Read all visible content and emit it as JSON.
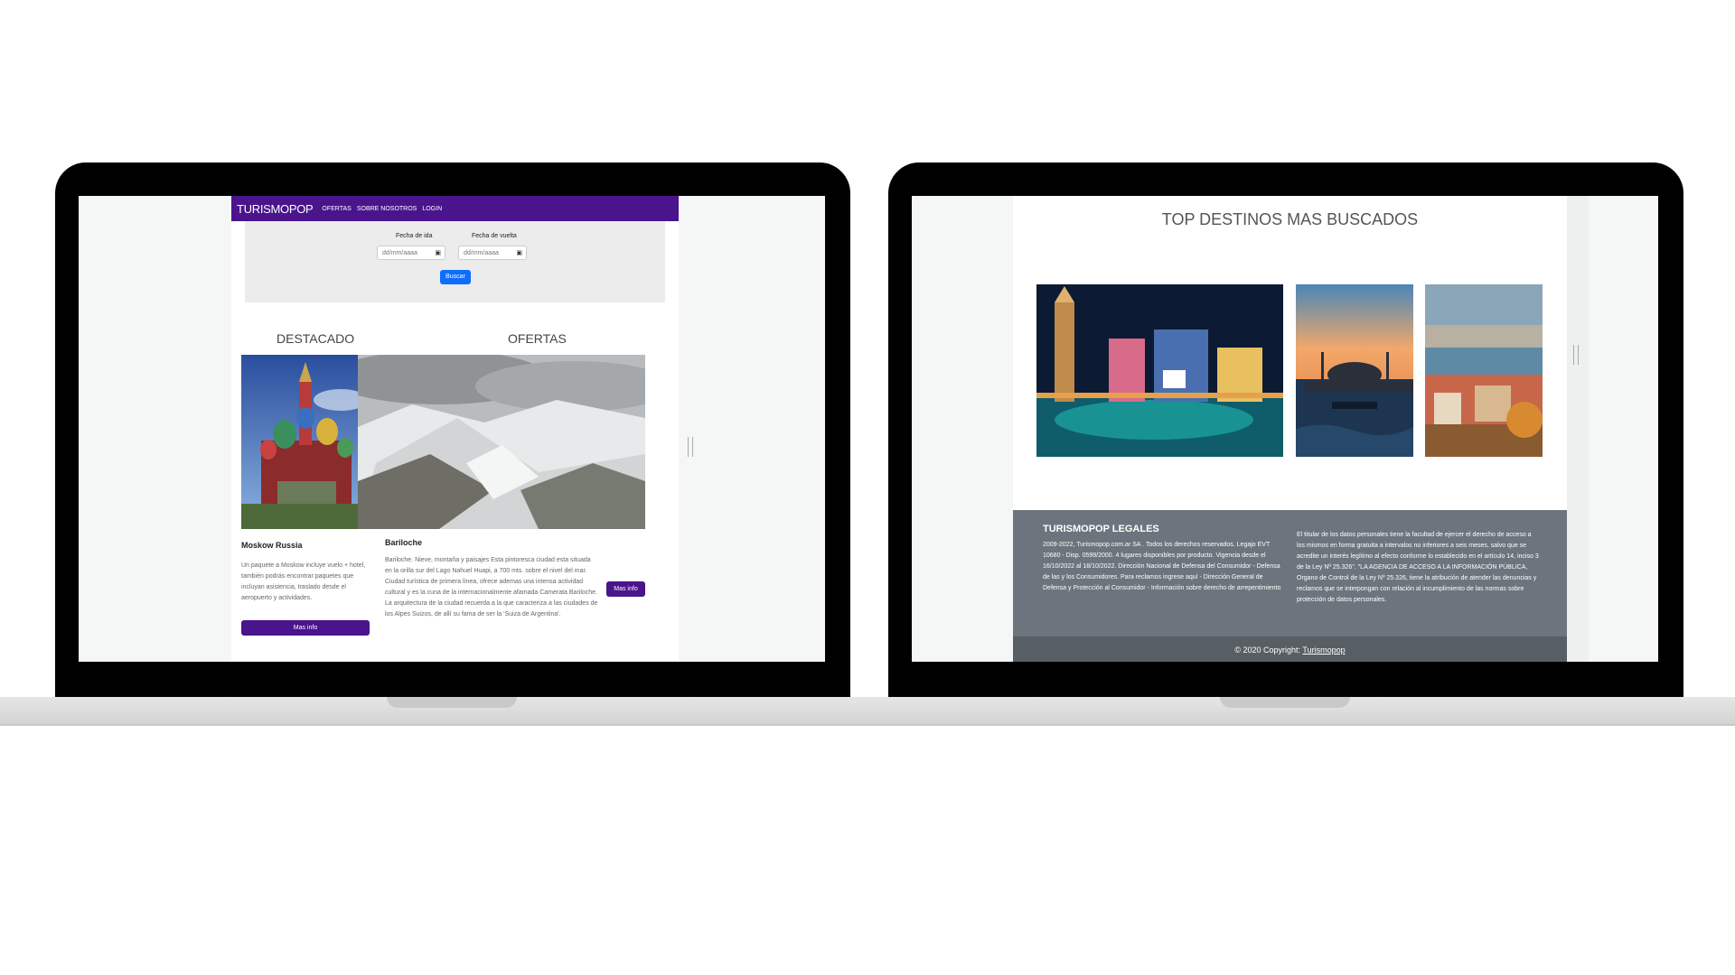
{
  "left": {
    "navbar": {
      "brand": "TURISMOPOP",
      "links": [
        "OFERTAS",
        "SOBRE NOSOTROS",
        "LOGIN"
      ]
    },
    "search": {
      "fecha_ida_label": "Fecha de ida",
      "fecha_vuelta_label": "Fecha de vuelta",
      "date_placeholder": "dd/mm/aaaa",
      "buscar_label": "Buscar"
    },
    "destacado": {
      "title": "DESTACADO",
      "card_title": "Moskow Russia",
      "card_text": "Un paquete a Moskow incluye vuelo + hotel, también podrás encontrar paquetes que incluyan asistencia, traslado desde el aeropuerto y actividades.",
      "button": "Mas info"
    },
    "ofertas": {
      "title": "OFERTAS",
      "card_title": "Bariloche",
      "card_text": "Bariloche. Nieve, montaña y paisajes Esta pintoresca ciudad esta situada en la orilla sur del Lago Nahuel Huapi, a 700 mts. sobre el nivel del mar. Ciudad turística de primera línea, ofrece ademas una intensa actividad cultural y es la cuna de la internacionalmente afamada Camerata Bariloche. La arquitectura de la ciudad recuerda a la que caracteriza a las ciudades de los Alpes Suizos, de allí su fama de ser la 'Suiza de Argentina'.",
      "button": "Mas info"
    }
  },
  "right": {
    "top_title": "TOP DESTINOS MAS BUSCADOS",
    "footer": {
      "title": "TURISMOPOP LEGALES",
      "text_left": "2009-2022, Turismopop.com.ar SA . Todos los derechos reservados. Legajo EVT 10680 - Disp. 0599/2000. 4 lugares disponibles por producto. Vigencia desde el 16/10/2022 al 18/10/2022. Dirección Nacional de Defensa del Consumidor - Defensa de las y los Consumidores. Para reclamos ingrese aquí - Dirección General de Defensa y Protección al Consumidor - Información sobre derecho de arrepentimiento",
      "text_right": "El titular de los datos personales tiene la facultad de ejercer el derecho de acceso a los mismos en forma gratuita a intervalos no inferiores a seis meses, salvo que se acredite un interés legítimo al efecto conforme lo establecido en el artículo 14, inciso 3 de la Ley Nº 25.326\". \"LA AGENCIA DE ACCESO A LA INFORMACIÓN PÚBLICA, Organo de Control de la Ley Nº 25.326, tiene la atribución de atender las denuncias y reclamos que se interpongan con relación al incumplimiento de las normas sobre protección de datos personales.",
      "copyright_prefix": "© 2020 Copyright:",
      "copyright_link": "Turismopop"
    }
  },
  "colors": {
    "brand": "#4a148c",
    "primary_button": "#0d6efd",
    "footer_bg": "#6c757d"
  }
}
